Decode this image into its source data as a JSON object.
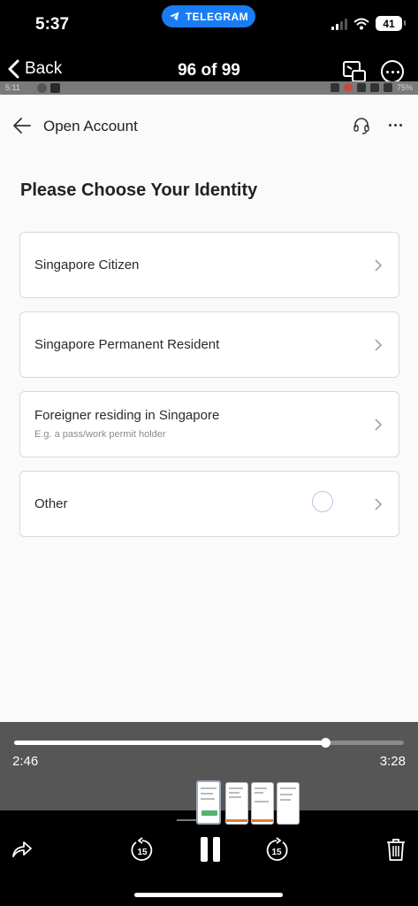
{
  "ios_status": {
    "time": "5:37",
    "pill_label": "TELEGRAM",
    "battery": "41"
  },
  "photo_nav": {
    "back_label": "Back",
    "counter": "96 of 99"
  },
  "recorded_status": {
    "time": "5:11",
    "battery": "75%"
  },
  "app": {
    "header_title": "Open Account",
    "heading": "Please Choose Your Identity",
    "options": [
      {
        "label": "Singapore Citizen",
        "sublabel": ""
      },
      {
        "label": "Singapore Permanent Resident",
        "sublabel": ""
      },
      {
        "label": "Foreigner residing in Singapore",
        "sublabel": "E.g. a pass/work permit holder"
      },
      {
        "label": "Other",
        "sublabel": ""
      }
    ],
    "icons": {
      "back": "arrow-left-icon",
      "support": "headset-icon",
      "more": "ellipsis-icon",
      "chevron": "chevron-right-icon",
      "loading": "spinner-icon"
    }
  },
  "player": {
    "elapsed": "2:46",
    "total": "3:28",
    "progress_fraction": 0.798,
    "skip_back_label": "15",
    "skip_forward_label": "15"
  },
  "colors": {
    "accent_blue": "#1a7cf2",
    "app_background": "#fafafa",
    "card_border": "#d9d9d9"
  }
}
